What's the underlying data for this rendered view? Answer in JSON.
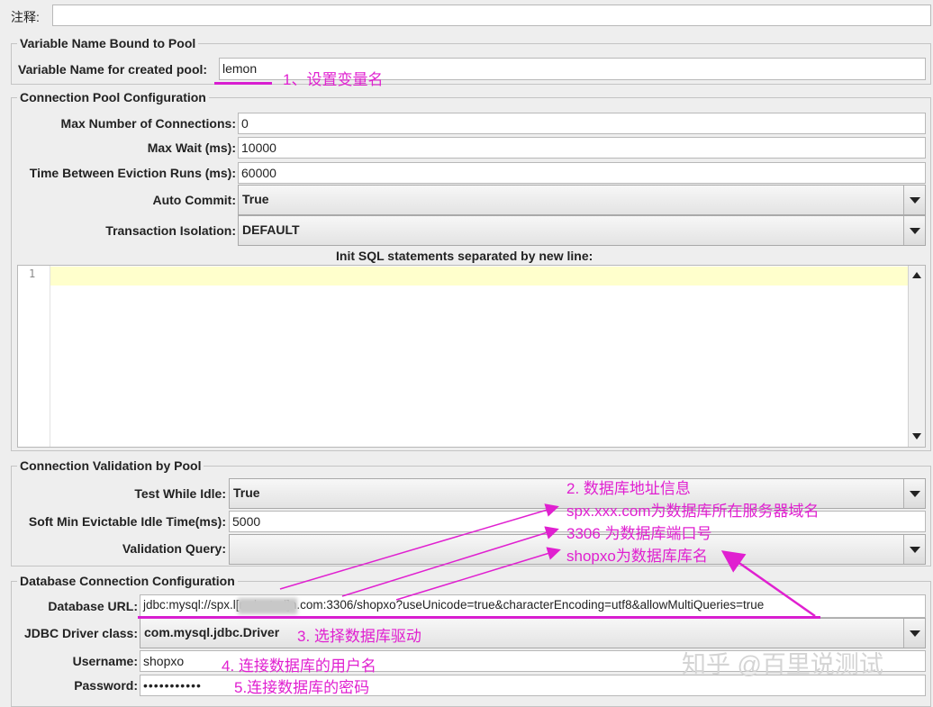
{
  "comment": {
    "label": "注释:",
    "value": ""
  },
  "pool_binding": {
    "title": "Variable Name Bound to Pool",
    "var_label": "Variable Name for created pool:",
    "var_value": "lemon"
  },
  "pool_config": {
    "title": "Connection Pool Configuration",
    "max_conn_label": "Max Number of Connections:",
    "max_conn_value": "0",
    "max_wait_label": "Max Wait (ms):",
    "max_wait_value": "10000",
    "eviction_label": "Time Between Eviction Runs (ms):",
    "eviction_value": "60000",
    "auto_commit_label": "Auto Commit:",
    "auto_commit_value": "True",
    "isolation_label": "Transaction Isolation:",
    "isolation_value": "DEFAULT",
    "init_sql_label": "Init SQL statements separated by new line:",
    "init_sql_line_number": "1"
  },
  "validation": {
    "title": "Connection Validation by Pool",
    "test_idle_label": "Test While Idle:",
    "test_idle_value": "True",
    "soft_min_label": "Soft Min Evictable Idle Time(ms):",
    "soft_min_value": "5000",
    "query_label": "Validation Query:",
    "query_value": ""
  },
  "db_config": {
    "title": "Database Connection Configuration",
    "url_label": "Database URL:",
    "url_value": "jdbc:mysql://spx.l[redacted]n.com:3306/shopxo?useUnicode=true&characterEncoding=utf8&allowMultiQueries=true",
    "driver_label": "JDBC Driver class:",
    "driver_value": "com.mysql.jdbc.Driver",
    "username_label": "Username:",
    "username_value": "shopxo",
    "password_label": "Password:",
    "password_value": "•••••••••••"
  },
  "annotations": {
    "a1": "1、设置变量名",
    "a2_1": "2. 数据库地址信息",
    "a2_2": "spx.xxx.com为数据库所在服务器域名",
    "a2_3": "3306 为数据库端口号",
    "a2_4": "shopxo为数据库库名",
    "a3": "3. 选择数据库驱动",
    "a4": "4. 连接数据库的用户名",
    "a5": "5.连接数据库的密码"
  },
  "watermark": "知乎 @百里说测试",
  "colors": {
    "annotation": "#e020d0",
    "highlight_line": "#ffffcc",
    "background": "#eeeeee"
  }
}
